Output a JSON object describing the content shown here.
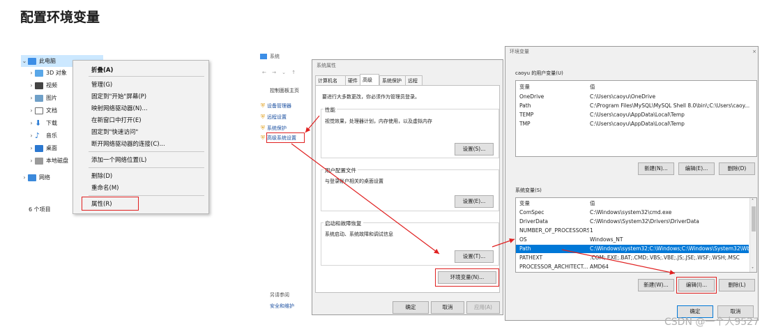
{
  "heading": "配置环境变量",
  "explorer": {
    "tree": [
      "此电脑",
      "3D 对象",
      "视频",
      "图片",
      "文档",
      "下载",
      "音乐",
      "桌面",
      "本地磁盘",
      "网络"
    ],
    "status": "6 个项目",
    "context_menu": [
      "折叠(A)",
      "管理(G)",
      "固定到\"开始\"屏幕(P)",
      "映射网络驱动器(N)...",
      "在新窗口中打开(E)",
      "固定到\"快速访问\"",
      "断开网络驱动器的连接(C)...",
      "添加一个网络位置(L)",
      "删除(D)",
      "重命名(M)",
      "属性(R)"
    ]
  },
  "system_window": {
    "title": "系统",
    "nav": "← → ⌄ ↑",
    "home_link": "控制面板主页",
    "links": [
      "设备管理器",
      "远程设置",
      "系统保护",
      "高级系统设置"
    ],
    "see_also": "另请参阅",
    "security": "安全和维护"
  },
  "sys_props": {
    "title": "系统属性",
    "tabs": [
      "计算机名",
      "硬件",
      "高级",
      "系统保护",
      "远程"
    ],
    "admin_note": "要进行大多数更改，你必须作为管理员登录。",
    "perf_title": "性能",
    "perf_desc": "视觉效果，处理器计划，内存使用，以及虚拟内存",
    "perf_btn": "设置(S)...",
    "profile_title": "用户配置文件",
    "profile_desc": "与登录帐户相关的桌面设置",
    "profile_btn": "设置(E)...",
    "startup_title": "启动和故障恢复",
    "startup_desc": "系统启动、系统故障和调试信息",
    "startup_btn": "设置(T)...",
    "env_btn": "环境变量(N)...",
    "ok": "确定",
    "cancel": "取消",
    "apply": "应用(A)"
  },
  "env_vars": {
    "title": "环境变量",
    "user_label": "caoyu 的用户变量(U)",
    "col_var": "变量",
    "col_val": "值",
    "user_vars": [
      {
        "name": "OneDrive",
        "value": "C:\\Users\\caoyu\\OneDrive"
      },
      {
        "name": "Path",
        "value": "C:\\Program Files\\MySQL\\MySQL Shell 8.0\\bin\\;C:\\Users\\caoy..."
      },
      {
        "name": "TEMP",
        "value": "C:\\Users\\caoyu\\AppData\\Local\\Temp"
      },
      {
        "name": "TMP",
        "value": "C:\\Users\\caoyu\\AppData\\Local\\Temp"
      }
    ],
    "user_buttons": [
      "新建(N)...",
      "编辑(E)...",
      "删除(D)"
    ],
    "sys_label": "系统变量(S)",
    "sys_vars": [
      {
        "name": "ComSpec",
        "value": "C:\\Windows\\system32\\cmd.exe"
      },
      {
        "name": "DriverData",
        "value": "C:\\Windows\\System32\\Drivers\\DriverData"
      },
      {
        "name": "NUMBER_OF_PROCESSORS",
        "value": "1"
      },
      {
        "name": "OS",
        "value": "Windows_NT"
      },
      {
        "name": "Path",
        "value": "C:\\Windows\\system32;C:\\Windows;C:\\Windows\\System32\\Wb..."
      },
      {
        "name": "PATHEXT",
        "value": ".COM;.EXE;.BAT;.CMD;.VBS;.VBE;.JS;.JSE;.WSF;.WSH;.MSC"
      },
      {
        "name": "PROCESSOR_ARCHITECT...",
        "value": "AMD64"
      }
    ],
    "sys_buttons": [
      "新建(W)...",
      "编辑(I)...",
      "删除(L)"
    ],
    "ok": "确定",
    "cancel": "取消"
  },
  "watermark": "CSDN @一个人9527"
}
